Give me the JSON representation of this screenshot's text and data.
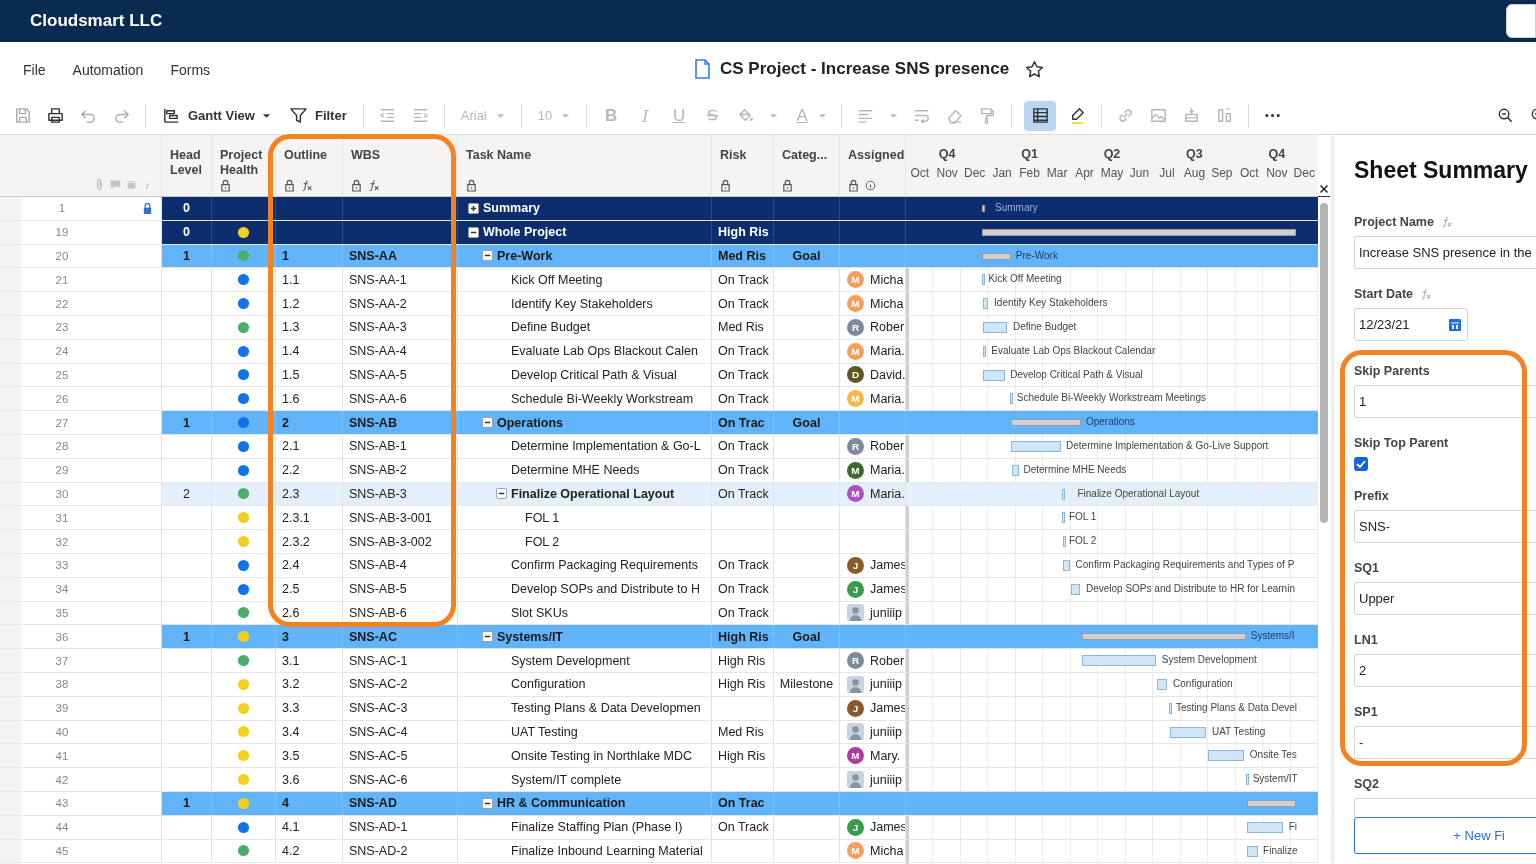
{
  "app": {
    "org": "Cloudsmart LLC"
  },
  "menu": [
    "File",
    "Automation",
    "Forms"
  ],
  "sheet_title": "CS Project - Increase SNS presence",
  "favorite": false,
  "toolbar": {
    "view": "Gantt View",
    "filter": "Filter",
    "font": "Arial",
    "size": "10",
    "bold": "B",
    "italic": "I",
    "underline": "U",
    "font_color": "A",
    "grid_view_selected": true
  },
  "grid": {
    "columns": [
      {
        "label": "Head Level"
      },
      {
        "label": "Project Health",
        "locked": true
      },
      {
        "label": "Outline",
        "locked": true,
        "formula": true
      },
      {
        "label": "WBS",
        "locked": true,
        "formula": true
      },
      {
        "label": "Task Name",
        "locked": true
      },
      {
        "label": "Risk",
        "locked": true
      },
      {
        "label": "Categ...",
        "locked": true
      },
      {
        "label": "Assigned",
        "locked": true,
        "info": true
      }
    ],
    "rows": [
      {
        "n": "1",
        "kind": "summary",
        "locked": true,
        "level": "0",
        "task": "Summary",
        "expanded": false,
        "bar_label": "Summary"
      },
      {
        "n": "19",
        "kind": "summary",
        "locked": false,
        "level": "0",
        "color": "#f5cf1f",
        "task": "Whole Project",
        "risk": "High Ris",
        "expanded": true,
        "children": [
          {
            "n": "20",
            "kind": "phase",
            "locked": false,
            "level": "1",
            "color": "#4cad6a",
            "outline": "1",
            "wbs": "SNS-AA",
            "task": "Pre-Work",
            "risk": "Med Ris",
            "category": "Goal",
            "expanded": true,
            "bar_label": "Pre-Work",
            "children": [
              {
                "n": "21",
                "kind": "task",
                "locked": false,
                "color": "#1273e6",
                "outline": "1.1",
                "wbs": "SNS-AA-1",
                "task": "Kick Off Meeting",
                "risk": "On Track",
                "assignee": {
                  "kind": "initial",
                  "initial": "M",
                  "color": "#f5a05a",
                  "name": "Micha"
                },
                "bar_label": "Kick Off Meeting"
              },
              {
                "n": "22",
                "kind": "task",
                "locked": false,
                "color": "#1273e6",
                "outline": "1.2",
                "wbs": "SNS-AA-2",
                "task": "Identify Key Stakeholders",
                "risk": "On Track",
                "assignee": {
                  "kind": "initial",
                  "initial": "M",
                  "color": "#f5a05a",
                  "name": "Micha"
                },
                "bar_label": "Identify Key Stakeholders"
              },
              {
                "n": "23",
                "kind": "task",
                "locked": false,
                "color": "#4cad6a",
                "outline": "1.3",
                "wbs": "SNS-AA-3",
                "task": "Define Budget",
                "risk": "Med Ris",
                "assignee": {
                  "kind": "initial",
                  "initial": "R",
                  "color": "#7d8a99",
                  "name": "Rober"
                },
                "bar_label": "Define Budget"
              },
              {
                "n": "24",
                "kind": "task",
                "locked": false,
                "color": "#1273e6",
                "outline": "1.4",
                "wbs": "SNS-AA-4",
                "task": "Evaluate Lab Ops Blackout Calen",
                "risk": "On Track",
                "assignee": {
                  "kind": "initial",
                  "initial": "M",
                  "color": "#f5a05a",
                  "name": "Maria."
                },
                "bar_label": "Evaluate Lab Ops Blackout Calendar"
              },
              {
                "n": "25",
                "kind": "task",
                "locked": false,
                "color": "#1273e6",
                "outline": "1.5",
                "wbs": "SNS-AA-5",
                "task": "Develop Critical Path & Visual",
                "risk": "On Track",
                "assignee": {
                  "kind": "initial",
                  "initial": "D",
                  "color": "#5c5a1e",
                  "name": "David."
                },
                "bar_label": "Develop Critical Path & Visual"
              },
              {
                "n": "26",
                "kind": "task",
                "locked": false,
                "color": "#1273e6",
                "outline": "1.6",
                "wbs": "SNS-AA-6",
                "task": "Schedule Bi-Weekly Workstream",
                "risk": "On Track",
                "assignee": {
                  "kind": "initial",
                  "initial": "M",
                  "color": "#f7b944",
                  "name": "Maria."
                },
                "bar_label": "Schedule Bi-Weekly Workstream Meetings"
              }
            ]
          },
          {
            "n": "27",
            "kind": "phase",
            "locked": false,
            "level": "1",
            "color": "#1273e6",
            "outline": "2",
            "wbs": "SNS-AB",
            "task": "Operations",
            "risk": "On Trac",
            "category": "Goal",
            "expanded": true,
            "bar_label": "Operations",
            "children": [
              {
                "n": "28",
                "kind": "task",
                "locked": false,
                "color": "#1273e6",
                "outline": "2.1",
                "wbs": "SNS-AB-1",
                "task": "Determine Implementation & Go-L",
                "risk": "On Track",
                "assignee": {
                  "kind": "initial",
                  "initial": "R",
                  "color": "#7d8a99",
                  "name": "Rober"
                },
                "bar_label": "Determine Implementation & Go-Live Support"
              },
              {
                "n": "29",
                "kind": "task",
                "locked": false,
                "color": "#1273e6",
                "outline": "2.2",
                "wbs": "SNS-AB-2",
                "task": "Determine MHE Needs",
                "risk": "On Track",
                "assignee": {
                  "kind": "initial",
                  "initial": "M",
                  "color": "#3e6b2c",
                  "name": "Maria."
                },
                "bar_label": "Determine MHE Needs"
              },
              {
                "n": "30",
                "kind": "group",
                "locked": false,
                "level": "2",
                "color": "#4cad6a",
                "outline": "2.3",
                "wbs": "SNS-AB-3",
                "task": "Finalize Operational Layout",
                "risk": "On Track",
                "assignee": {
                  "kind": "initial",
                  "initial": "M",
                  "color": "#b04fc0",
                  "name": "Maria."
                },
                "expanded": true,
                "bar_label": "Finalize Operational Layout",
                "children": [
                  {
                    "n": "31",
                    "kind": "task",
                    "locked": false,
                    "color": "#f5cf1f",
                    "outline": "2.3.1",
                    "wbs": "SNS-AB-3-001",
                    "task": "FOL 1",
                    "bar_label": "FOL 1"
                  },
                  {
                    "n": "32",
                    "kind": "task",
                    "locked": false,
                    "color": "#f5cf1f",
                    "outline": "2.3.2",
                    "wbs": "SNS-AB-3-002",
                    "task": "FOL 2",
                    "bar_label": "FOL 2"
                  }
                ]
              },
              {
                "n": "33",
                "kind": "task",
                "locked": false,
                "color": "#1273e6",
                "outline": "2.4",
                "wbs": "SNS-AB-4",
                "task": "Confirm Packaging Requirements",
                "risk": "On Track",
                "assignee": {
                  "kind": "initial",
                  "initial": "J",
                  "color": "#8b5a2b",
                  "name": "James"
                },
                "bar_label": "Confirm Packaging Requirements and Types of P"
              },
              {
                "n": "34",
                "kind": "task",
                "locked": false,
                "color": "#1273e6",
                "outline": "2.5",
                "wbs": "SNS-AB-5",
                "task": "Develop SOPs and Distribute to H",
                "risk": "On Track",
                "assignee": {
                  "kind": "initial",
                  "initial": "J",
                  "color": "#3a9a4e",
                  "name": "James"
                },
                "bar_label": "Develop SOPs and Distribute to HR for Learnin"
              },
              {
                "n": "35",
                "kind": "task",
                "locked": false,
                "color": "#4cad6a",
                "outline": "2.6",
                "wbs": "SNS-AB-6",
                "task": "Slot SKUs",
                "risk": "On Track",
                "assignee": {
                  "kind": "photo",
                  "name": "juniiip"
                }
              }
            ]
          },
          {
            "n": "36",
            "kind": "phase",
            "locked": false,
            "level": "1",
            "color": "#f5cf1f",
            "outline": "3",
            "wbs": "SNS-AC",
            "task": "Systems/IT",
            "risk": "High Ris",
            "category": "Goal",
            "expanded": true,
            "bar_label": "Systems/I",
            "children": [
              {
                "n": "37",
                "kind": "task",
                "locked": false,
                "color": "#4cad6a",
                "outline": "3.1",
                "wbs": "SNS-AC-1",
                "task": "System Development",
                "risk": "High Ris",
                "assignee": {
                  "kind": "initial",
                  "initial": "R",
                  "color": "#7d8a99",
                  "name": "Rober"
                },
                "bar_label": "System Development"
              },
              {
                "n": "38",
                "kind": "task",
                "locked": false,
                "color": "#f5cf1f",
                "outline": "3.2",
                "wbs": "SNS-AC-2",
                "task": "Configuration",
                "risk": "High Ris",
                "category": "Milestone",
                "assignee": {
                  "kind": "photo",
                  "name": "juniiip"
                },
                "bar_label": "Configuration"
              },
              {
                "n": "39",
                "kind": "task",
                "locked": false,
                "color": "#f5cf1f",
                "outline": "3.3",
                "wbs": "SNS-AC-3",
                "task": "Testing Plans & Data Developmen",
                "assignee": {
                  "kind": "initial",
                  "initial": "J",
                  "color": "#8b5a2b",
                  "name": "James"
                },
                "bar_label": "Testing Plans & Data Devel"
              },
              {
                "n": "40",
                "kind": "task",
                "locked": false,
                "color": "#f5cf1f",
                "outline": "3.4",
                "wbs": "SNS-AC-4",
                "task": "UAT Testing",
                "risk": "Med Ris",
                "assignee": {
                  "kind": "photo",
                  "name": "juniiip"
                },
                "bar_label": "UAT Testing"
              },
              {
                "n": "41",
                "kind": "task",
                "locked": false,
                "color": "#f5cf1f",
                "outline": "3.5",
                "wbs": "SNS-AC-5",
                "task": "Onsite Testing in Northlake MDC",
                "risk": "High Ris",
                "assignee": {
                  "kind": "initial",
                  "initial": "M",
                  "color": "#b03a9e",
                  "name": "Mary."
                },
                "bar_label": "Onsite Tes"
              },
              {
                "n": "42",
                "kind": "task",
                "locked": false,
                "color": "#f5cf1f",
                "outline": "3.6",
                "wbs": "SNS-AC-6",
                "task": "System/IT complete",
                "assignee": {
                  "kind": "photo",
                  "name": "juniiip"
                },
                "bar_label": "System/IT"
              }
            ]
          },
          {
            "n": "43",
            "kind": "phase",
            "locked": false,
            "level": "1",
            "color": "#f5cf1f",
            "outline": "4",
            "wbs": "SNS-AD",
            "task": "HR & Communication",
            "risk": "On Trac",
            "expanded": true,
            "children": [
              {
                "n": "44",
                "kind": "task",
                "locked": false,
                "color": "#1273e6",
                "outline": "4.1",
                "wbs": "SNS-AD-1",
                "task": "Finalize Staffing Plan (Phase I)",
                "risk": "On Track",
                "assignee": {
                  "kind": "initial",
                  "initial": "J",
                  "color": "#3a9a4e",
                  "name": "James"
                },
                "bar_label": "Fi"
              },
              {
                "n": "45",
                "kind": "task",
                "locked": false,
                "color": "#4cad6a",
                "outline": "4.2",
                "wbs": "SNS-AD-2",
                "task": "Finalize Inbound Learning Material",
                "assignee": {
                  "kind": "initial",
                  "initial": "M",
                  "color": "#f5a05a",
                  "name": "Micha"
                },
                "bar_label": "Finalize"
              }
            ]
          }
        ]
      }
    ]
  },
  "gantt": {
    "quarters": [
      {
        "label": "Q4"
      },
      {
        "label": "Q1"
      },
      {
        "label": "Q2"
      },
      {
        "label": "Q3"
      },
      {
        "label": "Q4"
      }
    ],
    "months": [
      "Oct",
      "Nov",
      "Dec",
      "Jan",
      "Feb",
      "Mar",
      "Apr",
      "May",
      "Jun",
      "Jul",
      "Aug",
      "Sep",
      "Oct",
      "Nov",
      "Dec"
    ]
  },
  "summary_panel": {
    "title": "Sheet Summary",
    "fields": [
      {
        "kind": "text",
        "label": "Project Name",
        "formula": true,
        "value": "Increase SNS presence in the"
      },
      {
        "kind": "date",
        "label": "Start Date",
        "formula": true,
        "value": "12/23/21"
      },
      {
        "kind": "text",
        "label": "Skip Parents",
        "value": "1"
      },
      {
        "kind": "checkbox",
        "label": "Skip Top Parent",
        "checked": true
      },
      {
        "kind": "text",
        "label": "Prefix",
        "value": "SNS-"
      },
      {
        "kind": "text",
        "label": "SQ1",
        "value": "Upper"
      },
      {
        "kind": "text",
        "label": "LN1",
        "value": "2"
      },
      {
        "kind": "text",
        "label": "SP1",
        "value": "-"
      },
      {
        "kind": "text",
        "label": "SQ2"
      }
    ],
    "new_field_button": "+ New Fi"
  }
}
